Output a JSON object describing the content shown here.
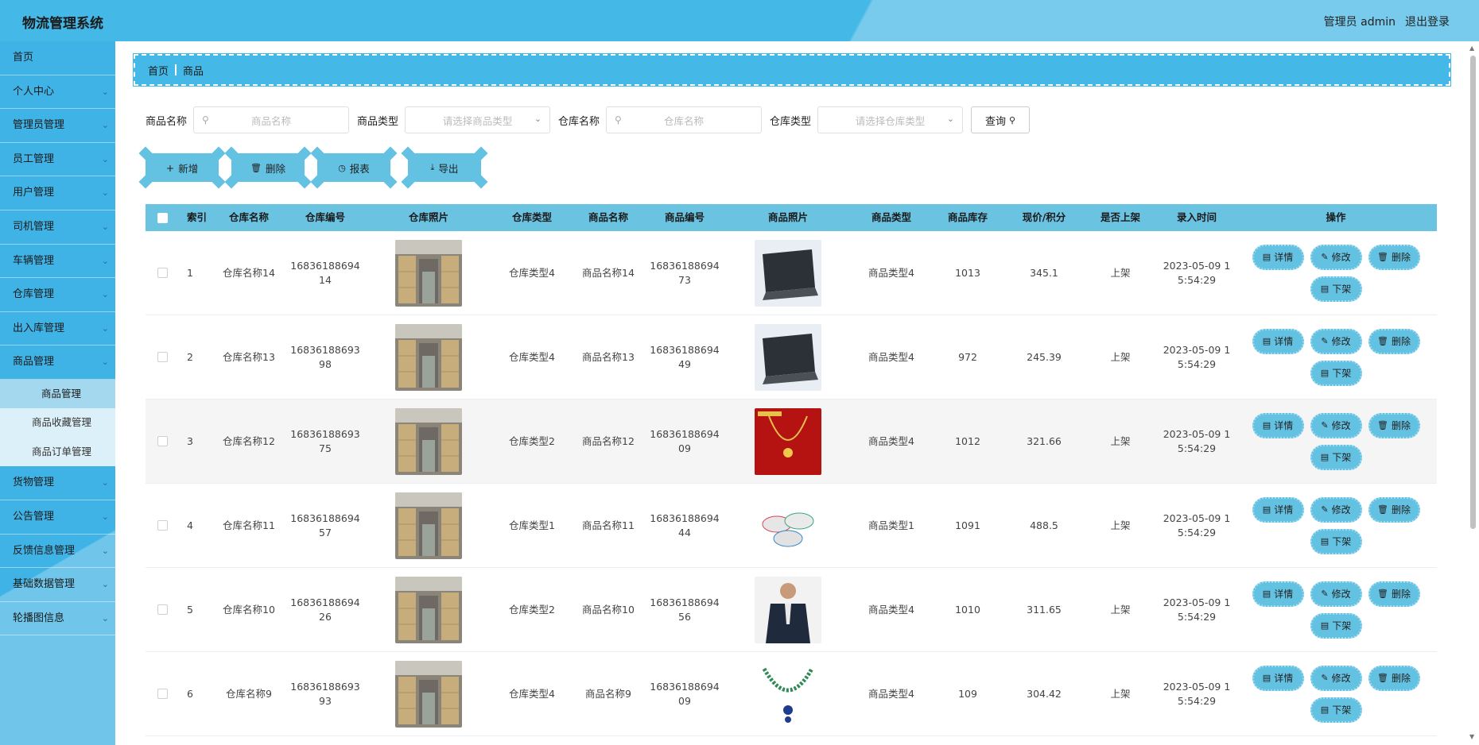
{
  "header": {
    "title": "物流管理系统",
    "user": "管理员 admin",
    "logout": "退出登录"
  },
  "sidebar": {
    "items": [
      {
        "label": "首页",
        "has_children": false
      },
      {
        "label": "个人中心",
        "has_children": true
      },
      {
        "label": "管理员管理",
        "has_children": true
      },
      {
        "label": "员工管理",
        "has_children": true
      },
      {
        "label": "用户管理",
        "has_children": true
      },
      {
        "label": "司机管理",
        "has_children": true
      },
      {
        "label": "车辆管理",
        "has_children": true
      },
      {
        "label": "仓库管理",
        "has_children": true
      },
      {
        "label": "出入库管理",
        "has_children": true
      },
      {
        "label": "商品管理",
        "has_children": true
      },
      {
        "label": "货物管理",
        "has_children": true
      },
      {
        "label": "公告管理",
        "has_children": true
      },
      {
        "label": "反馈信息管理",
        "has_children": true
      },
      {
        "label": "基础数据管理",
        "has_children": true
      },
      {
        "label": "轮播图信息",
        "has_children": true
      }
    ],
    "submenu": {
      "parent": "商品管理",
      "items": [
        "商品管理",
        "商品收藏管理",
        "商品订单管理"
      ],
      "active": "商品管理"
    }
  },
  "breadcrumb": {
    "home": "首页",
    "current": "商品"
  },
  "search": {
    "goods_name_label": "商品名称",
    "goods_name_placeholder": "商品名称",
    "goods_type_label": "商品类型",
    "goods_type_placeholder": "请选择商品类型",
    "warehouse_name_label": "仓库名称",
    "warehouse_name_placeholder": "仓库名称",
    "warehouse_type_label": "仓库类型",
    "warehouse_type_placeholder": "请选择仓库类型",
    "query_label": "查询"
  },
  "toolbar": {
    "add": "新增",
    "delete": "删除",
    "report": "报表",
    "export": "导出"
  },
  "table": {
    "columns": [
      "索引",
      "仓库名称",
      "仓库编号",
      "仓库照片",
      "仓库类型",
      "商品名称",
      "商品编号",
      "商品照片",
      "商品类型",
      "商品库存",
      "现价/积分",
      "是否上架",
      "录入时间",
      "操作"
    ],
    "ops": {
      "detail": "详情",
      "edit": "修改",
      "delete": "删除",
      "unshelf": "下架"
    },
    "rows": [
      {
        "idx": "1",
        "warehouse_name": "仓库名称14",
        "warehouse_no": [
          "16836188694",
          "14"
        ],
        "warehouse_type": "仓库类型4",
        "goods_name": "商品名称14",
        "goods_no": [
          "16836188694",
          "73"
        ],
        "goods_type": "商品类型4",
        "stock": "1013",
        "price": "345.1",
        "on_shelf": "上架",
        "time": [
          "2023-05-09 1",
          "5:54:29"
        ],
        "warehouse_img": "warehouse-photo",
        "goods_img": "laptop-photo"
      },
      {
        "idx": "2",
        "warehouse_name": "仓库名称13",
        "warehouse_no": [
          "16836188693",
          "98"
        ],
        "warehouse_type": "仓库类型4",
        "goods_name": "商品名称13",
        "goods_no": [
          "16836188694",
          "49"
        ],
        "goods_type": "商品类型4",
        "stock": "972",
        "price": "245.39",
        "on_shelf": "上架",
        "time": [
          "2023-05-09 1",
          "5:54:29"
        ],
        "warehouse_img": "warehouse-photo",
        "goods_img": "laptop-photo"
      },
      {
        "idx": "3",
        "warehouse_name": "仓库名称12",
        "warehouse_no": [
          "16836188693",
          "75"
        ],
        "warehouse_type": "仓库类型2",
        "goods_name": "商品名称12",
        "goods_no": [
          "16836188694",
          "09"
        ],
        "goods_type": "商品类型4",
        "stock": "1012",
        "price": "321.66",
        "on_shelf": "上架",
        "time": [
          "2023-05-09 1",
          "5:54:29"
        ],
        "warehouse_img": "warehouse-photo",
        "goods_img": "necklace-photo"
      },
      {
        "idx": "4",
        "warehouse_name": "仓库名称11",
        "warehouse_no": [
          "16836188694",
          "57"
        ],
        "warehouse_type": "仓库类型1",
        "goods_name": "商品名称11",
        "goods_no": [
          "16836188694",
          "44"
        ],
        "goods_type": "商品类型1",
        "stock": "1091",
        "price": "488.5",
        "on_shelf": "上架",
        "time": [
          "2023-05-09 1",
          "5:54:29"
        ],
        "warehouse_img": "warehouse-photo",
        "goods_img": "bowls-photo"
      },
      {
        "idx": "5",
        "warehouse_name": "仓库名称10",
        "warehouse_no": [
          "16836188694",
          "26"
        ],
        "warehouse_type": "仓库类型2",
        "goods_name": "商品名称10",
        "goods_no": [
          "16836188694",
          "56"
        ],
        "goods_type": "商品类型4",
        "stock": "1010",
        "price": "311.65",
        "on_shelf": "上架",
        "time": [
          "2023-05-09 1",
          "5:54:29"
        ],
        "warehouse_img": "warehouse-photo",
        "goods_img": "jacket-photo"
      },
      {
        "idx": "6",
        "warehouse_name": "仓库名称9",
        "warehouse_no": [
          "16836188693",
          "93"
        ],
        "warehouse_type": "仓库类型4",
        "goods_name": "商品名称9",
        "goods_no": [
          "16836188694",
          "09"
        ],
        "goods_type": "商品类型4",
        "stock": "109",
        "price": "304.42",
        "on_shelf": "上架",
        "time": [
          "2023-05-09 1",
          "5:54:29"
        ],
        "warehouse_img": "warehouse-photo",
        "goods_img": "gem-necklace-photo"
      }
    ]
  },
  "colors": {
    "primary": "#44b8e6",
    "button": "#63c1e2",
    "table_header": "#6bc3e2"
  }
}
